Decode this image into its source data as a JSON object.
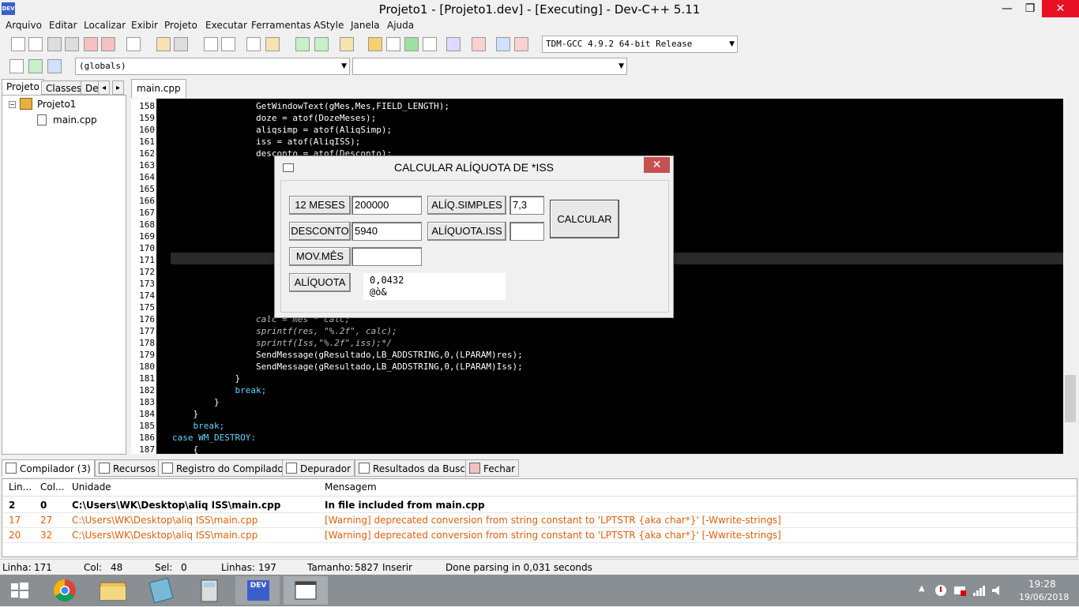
{
  "window": {
    "title": "Projeto1 - [Projeto1.dev] - [Executing] - Dev-C++ 5.11",
    "icon": "dev-cpp-icon",
    "min": "—",
    "max": "❐",
    "close": "✕"
  },
  "menu": [
    "Arquivo",
    "Editar",
    "Localizar",
    "Exibir",
    "Projeto",
    "Executar",
    "Ferramentas",
    "AStyle",
    "Janela",
    "Ajuda"
  ],
  "toolbar": {
    "compiler": "TDM-GCC 4.9.2 64-bit Release",
    "scope": "(globals)",
    "function": ""
  },
  "left": {
    "tabs": [
      "Projeto",
      "Classes",
      "De"
    ],
    "tree": {
      "project": "Projeto1",
      "file": "main.cpp"
    },
    "nav_left": "◂",
    "nav_right": "▸"
  },
  "editor": {
    "tab": "main.cpp",
    "lines": [
      {
        "n": "158",
        "c": "                GetWindowText(gMes,Mes,FIELD_LENGTH);"
      },
      {
        "n": "159",
        "c": "                doze = atof(DozeMeses);"
      },
      {
        "n": "160",
        "c": "                aliqsimp = atof(AliqSimp);"
      },
      {
        "n": "161",
        "c": "                iss = atof(AliqISS);"
      },
      {
        "n": "162",
        "c": "                desconto = atof(Desconto);"
      },
      {
        "n": "163",
        "c": ""
      },
      {
        "n": "164",
        "c": ""
      },
      {
        "n": "165",
        "c": ""
      },
      {
        "n": "166",
        "c": ""
      },
      {
        "n": "167",
        "c": ""
      },
      {
        "n": "168",
        "c": ""
      },
      {
        "n": "169",
        "c": ""
      },
      {
        "n": "170",
        "c": ""
      },
      {
        "n": "171",
        "c": ""
      },
      {
        "n": "172",
        "c": ""
      },
      {
        "n": "173",
        "c": ""
      },
      {
        "n": "174",
        "c": ""
      },
      {
        "n": "175",
        "c": ""
      },
      {
        "n": "176",
        "c": "                calc = mes * calc;"
      },
      {
        "n": "177",
        "c": "                sprintf(res, \"%.2f\", calc);"
      },
      {
        "n": "178",
        "c": "                sprintf(Iss,\"%.2f\",iss);*/"
      },
      {
        "n": "179",
        "c": "                SendMessage(gResultado,LB_ADDSTRING,0,(LPARAM)res);"
      },
      {
        "n": "180",
        "c": "                SendMessage(gResultado,LB_ADDSTRING,0,(LPARAM)Iss);"
      },
      {
        "n": "181",
        "c": "            }"
      },
      {
        "n": "182",
        "c": "            break;"
      },
      {
        "n": "183",
        "c": "        }"
      },
      {
        "n": "184",
        "c": "    }"
      },
      {
        "n": "185",
        "c": "    break;"
      },
      {
        "n": "186",
        "c": "case WM_DESTROY:"
      },
      {
        "n": "187",
        "c": "    {"
      }
    ]
  },
  "dialog": {
    "title": "CALCULAR ALÍQUOTA DE *ISS",
    "close": "✕",
    "icon": "window-icon",
    "labels": {
      "meses": "12 MESES",
      "desconto": "DESCONTO",
      "mov": "MOV.MÊS",
      "aliquota": "ALÍQUOTA",
      "aliq_simples": "ALÍQ.SIMPLES",
      "aliq_iss": "ALÍQUOTA.ISS"
    },
    "values": {
      "meses": "200000",
      "desconto": "5940",
      "mov": "",
      "aliq_simples": "7,3",
      "aliq_iss": ""
    },
    "button": "CALCULAR",
    "result_line1": "0,0432",
    "result_line2": "@ò&"
  },
  "bottom": {
    "tabs": [
      "Compilador (3)",
      "Recursos",
      "Registro do Compilador",
      "Depurador",
      "Resultados da Busca",
      "Fechar"
    ],
    "headers": [
      "Lin...",
      "Col...",
      "Unidade",
      "Mensagem"
    ],
    "rows": [
      {
        "lin": "2",
        "col": "0",
        "unit": "C:\\Users\\WK\\Desktop\\aliq ISS\\main.cpp",
        "msg": "In file included from main.cpp"
      },
      {
        "lin": "17",
        "col": "27",
        "unit": "C:\\Users\\WK\\Desktop\\aliq ISS\\main.cpp",
        "msg": "[Warning] deprecated conversion from string constant to 'LPTSTR {aka char*}' [-Wwrite-strings]"
      },
      {
        "lin": "20",
        "col": "32",
        "unit": "C:\\Users\\WK\\Desktop\\aliq ISS\\main.cpp",
        "msg": "[Warning] deprecated conversion from string constant to 'LPTSTR {aka char*}' [-Wwrite-strings]"
      }
    ]
  },
  "status": {
    "linha_label": "Linha:",
    "linha": "171",
    "col_label": "Col:",
    "col": "48",
    "sel_label": "Sel:",
    "sel": "0",
    "linhas_label": "Linhas:",
    "linhas": "197",
    "tam_label": "Tamanho:",
    "tam": "5827",
    "mode": "Inserir",
    "parse": "Done parsing in 0,031 seconds"
  },
  "taskbar": {
    "time": "19:28",
    "date": "19/06/2018",
    "dev_label": "DEV"
  }
}
